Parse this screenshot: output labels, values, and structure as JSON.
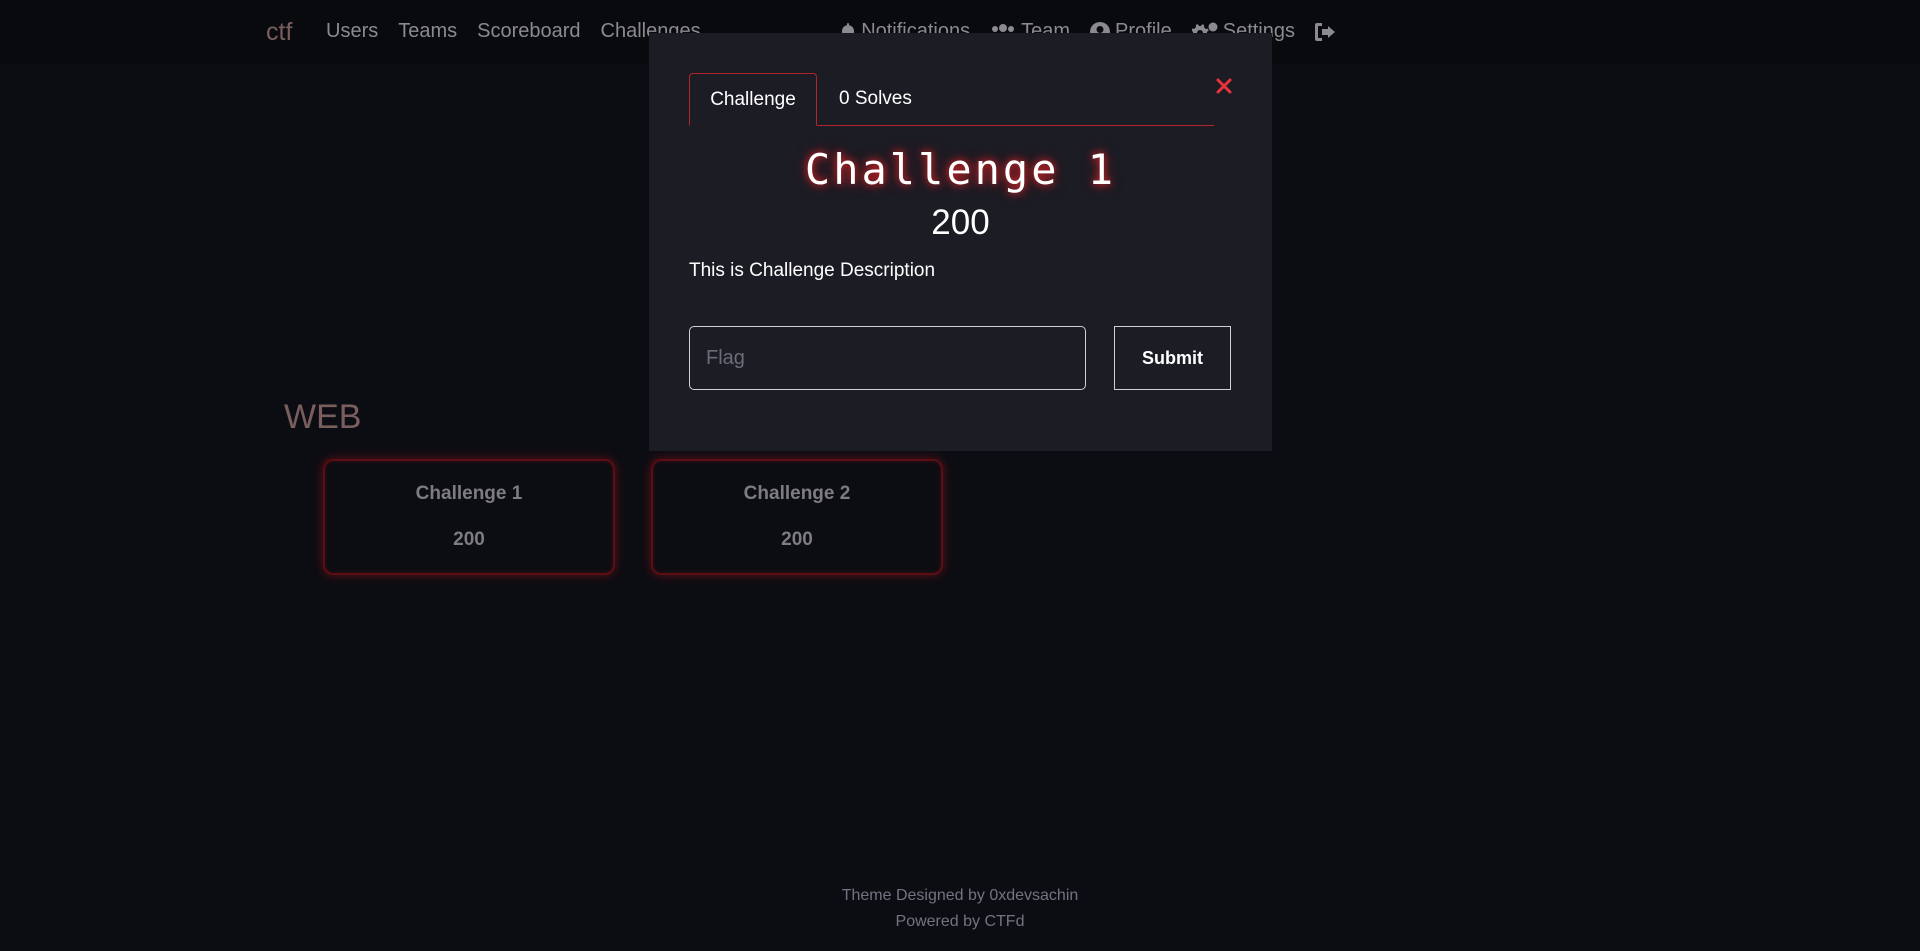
{
  "navbar": {
    "brand": "ctf",
    "left_links": [
      "Users",
      "Teams",
      "Scoreboard",
      "Challenges"
    ],
    "right_links": [
      {
        "label": "Notifications",
        "icon": "bell-icon"
      },
      {
        "label": "Team",
        "icon": "users-icon"
      },
      {
        "label": "Profile",
        "icon": "user-circle-icon"
      },
      {
        "label": "Settings",
        "icon": "cogs-icon"
      },
      {
        "label": "",
        "icon": "logout-icon"
      }
    ]
  },
  "category": {
    "title": "WEB",
    "challenges": [
      {
        "name": "Challenge 1",
        "points": "200"
      },
      {
        "name": "Challenge 2",
        "points": "200"
      }
    ]
  },
  "modal": {
    "tabs": [
      "Challenge",
      "0 Solves"
    ],
    "active_tab": 0,
    "title": "Challenge 1",
    "points": "200",
    "description": "This is Challenge Description",
    "flag_placeholder": "Flag",
    "flag_value": "",
    "submit_label": "Submit",
    "close_icon": "close-icon"
  },
  "footer": {
    "line1": "Theme Designed by 0xdevsachin",
    "line2": "Powered by CTFd"
  },
  "colors": {
    "accent": "#b3232b",
    "background": "#0c0d12",
    "modal_bg": "#1b1c24"
  }
}
